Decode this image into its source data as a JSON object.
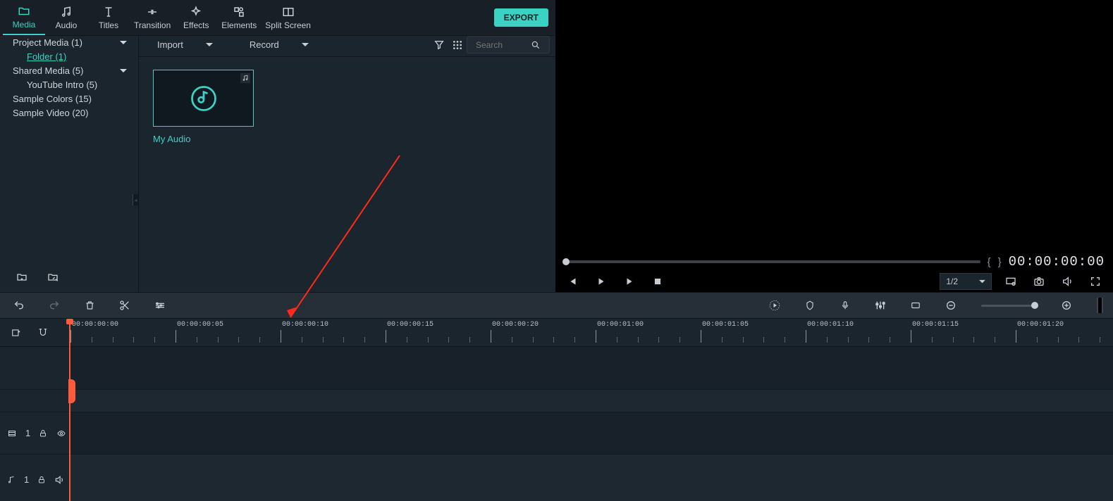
{
  "tabs": [
    {
      "label": "Media"
    },
    {
      "label": "Audio"
    },
    {
      "label": "Titles"
    },
    {
      "label": "Transition"
    },
    {
      "label": "Effects"
    },
    {
      "label": "Elements"
    },
    {
      "label": "Split Screen"
    }
  ],
  "export_label": "EXPORT",
  "tree": {
    "project_media": "Project Media (1)",
    "folder": "Folder (1)",
    "shared_media": "Shared Media (5)",
    "youtube_intro": "YouTube Intro (5)",
    "sample_colors": "Sample Colors (15)",
    "sample_video": "Sample Video (20)"
  },
  "browser": {
    "import": "Import",
    "record": "Record",
    "search_placeholder": "Search",
    "clip_name": "My Audio"
  },
  "preview": {
    "timecode": "00:00:00:00",
    "ratio": "1/2"
  },
  "ruler_labels": [
    "00:00:00:00",
    "00:00:00:05",
    "00:00:00:10",
    "00:00:00:15",
    "00:00:00:20",
    "00:00:01:00",
    "00:00:01:05",
    "00:00:01:10",
    "00:00:01:15",
    "00:00:01:20"
  ],
  "track_video_num": "1",
  "track_audio_num": "1"
}
